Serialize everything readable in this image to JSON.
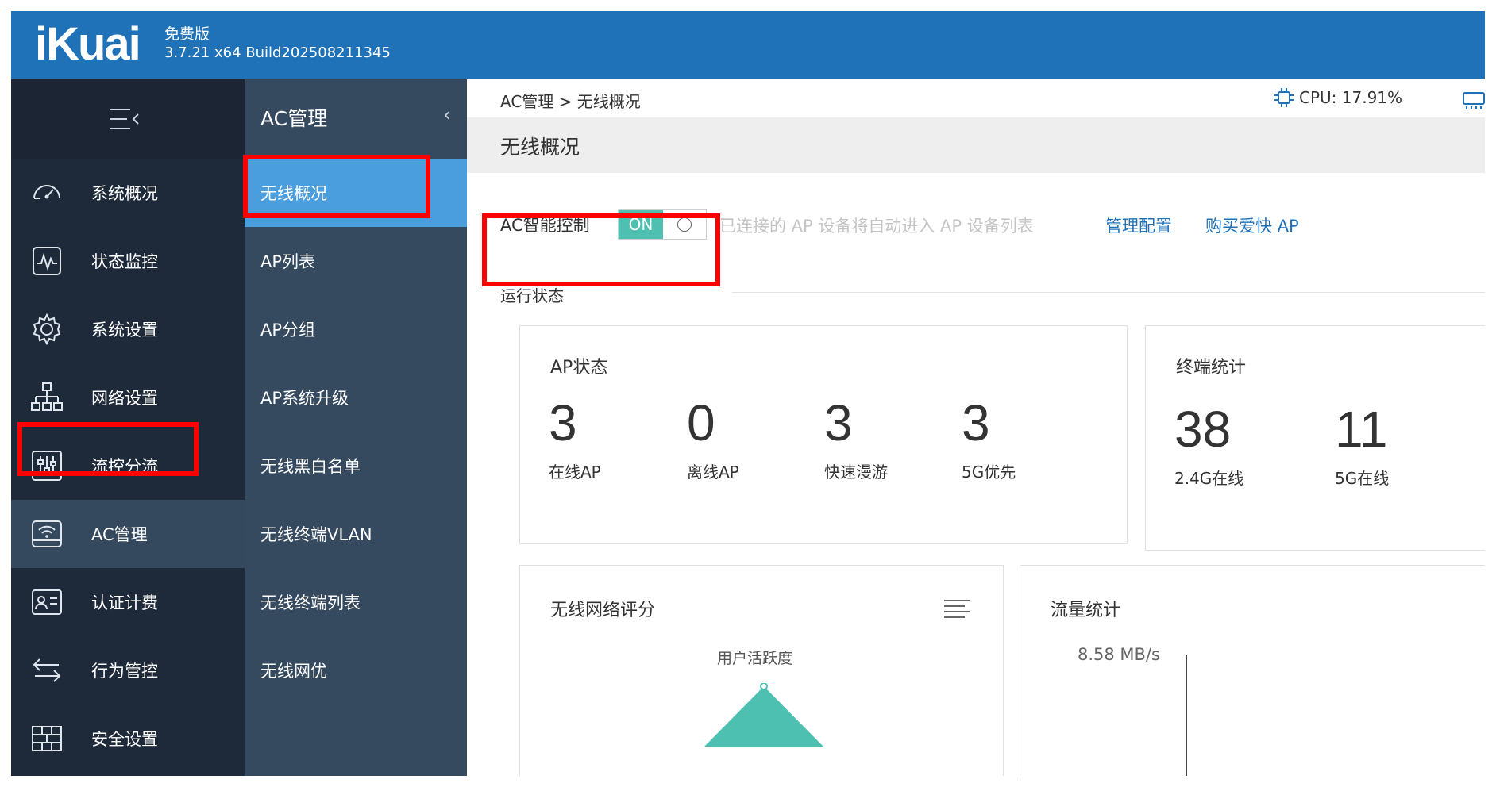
{
  "brand": {
    "logo": "iKuai",
    "edition": "免费版",
    "version": "3.7.21 x64 Build202508211345"
  },
  "nav": {
    "items": [
      {
        "label": "系统概况",
        "icon": "dashboard-icon"
      },
      {
        "label": "状态监控",
        "icon": "monitor-pulse-icon"
      },
      {
        "label": "系统设置",
        "icon": "gear-icon"
      },
      {
        "label": "网络设置",
        "icon": "network-topology-icon"
      },
      {
        "label": "流控分流",
        "icon": "sliders-icon"
      },
      {
        "label": "AC管理",
        "icon": "wifi-router-icon"
      },
      {
        "label": "认证计费",
        "icon": "id-card-icon"
      },
      {
        "label": "行为管控",
        "icon": "swap-arrows-icon"
      },
      {
        "label": "安全设置",
        "icon": "firewall-icon"
      }
    ],
    "active_index": 5
  },
  "subnav": {
    "title": "AC管理",
    "back_icon": "chevron-left-icon",
    "items": [
      "无线概况",
      "AP列表",
      "AP分组",
      "AP系统升级",
      "无线黑白名单",
      "无线终端VLAN",
      "无线终端列表",
      "无线网优"
    ],
    "active_index": 0
  },
  "header": {
    "breadcrumb": "AC管理  >  无线概况",
    "cpu": "CPU: 17.91%"
  },
  "page": {
    "title": "无线概况",
    "ac_control": {
      "label": "AC智能控制",
      "toggle_on": "ON",
      "hint": "已连接的 AP 设备将自动进入 AP 设备列表",
      "link_manage": "管理配置",
      "link_buy": "购买爱快 AP"
    },
    "run_status_label": "运行状态",
    "ap_status": {
      "title": "AP状态",
      "stats": [
        {
          "value": "3",
          "label": "在线AP"
        },
        {
          "value": "0",
          "label": "离线AP"
        },
        {
          "value": "3",
          "label": "快速漫游"
        },
        {
          "value": "3",
          "label": "5G优先"
        }
      ]
    },
    "terminal_stats": {
      "title": "终端统计",
      "stats": [
        {
          "value": "38",
          "label": "2.4G在线"
        },
        {
          "value": "11",
          "label": "5G在线"
        }
      ]
    },
    "wireless_score": {
      "title": "无线网络评分",
      "subtitle": "用户活跃度"
    },
    "traffic": {
      "title": "流量统计",
      "rate": "8.58 MB/s"
    }
  },
  "colors": {
    "topbar": "#1f72b8",
    "nav_bg": "#1e2a3a",
    "subnav_bg": "#35495f",
    "active_sub": "#4a9ede",
    "toggle_on": "#4ec0b2",
    "link": "#1f72b8",
    "highlight": "#ff0000"
  }
}
